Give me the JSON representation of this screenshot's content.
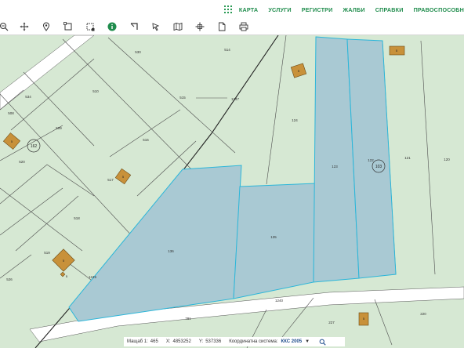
{
  "menu": {
    "items": [
      {
        "label": "КАРТА"
      },
      {
        "label": "УСЛУГИ"
      },
      {
        "label": "РЕГИСТРИ"
      },
      {
        "label": "ЖАЛБИ"
      },
      {
        "label": "СПРАВКИ"
      },
      {
        "label": "ПРАВОСПОСОБН"
      }
    ]
  },
  "toolbar": {
    "icons": [
      "zoom-out-icon",
      "pan-icon",
      "location-pin-icon",
      "select-area-icon",
      "select-polygon-icon",
      "info-icon",
      "corner-icon",
      "pointer-icon",
      "map-layers-icon",
      "crosshair-icon",
      "document-icon",
      "print-icon"
    ]
  },
  "map": {
    "colors": {
      "background": "#d6e8d3",
      "selected_fill": "#a9c9d3",
      "selected_stroke": "#2bb6d9",
      "parcel_line": "#4d4d4d",
      "road_fill": "#ffffff",
      "building": "#c8913a"
    },
    "parcel_labels": [
      "530",
      "514",
      "534",
      "510",
      "515",
      "124",
      "1247",
      "509",
      "520",
      "516",
      "122",
      "123",
      "121",
      "120",
      "508",
      "517",
      "518",
      "135",
      "136",
      "519",
      "1245",
      "526",
      "1240",
      "227",
      "220",
      "781"
    ],
    "markers": [
      "162",
      "103"
    ],
    "building_labels": [
      "5",
      "5",
      "5",
      "5",
      "5",
      "5",
      "5"
    ]
  },
  "status": {
    "scale_label": "Мащаб 1:",
    "scale_value": "465",
    "x_label": "X:",
    "x_value": "4853252",
    "y_label": "Y:",
    "y_value": "537336",
    "crs_label": "Координатна система:",
    "crs_value": "ККС 2005"
  }
}
